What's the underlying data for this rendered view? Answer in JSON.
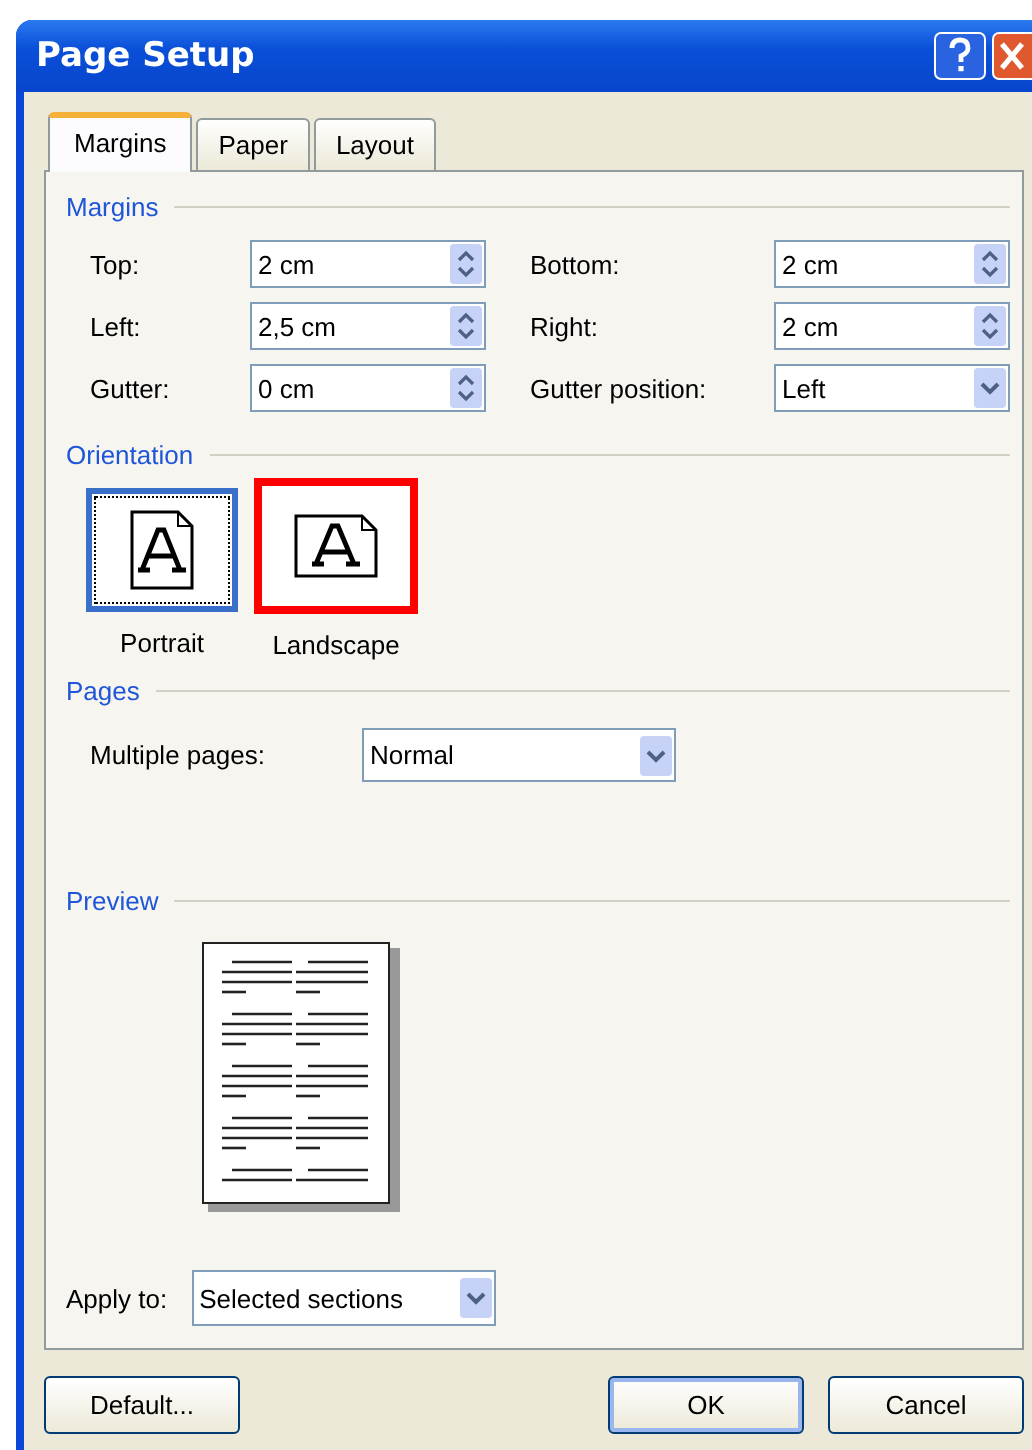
{
  "window": {
    "title": "Page Setup"
  },
  "tabs": [
    {
      "label": "Margins",
      "selected": true
    },
    {
      "label": "Paper",
      "selected": false
    },
    {
      "label": "Layout",
      "selected": false
    }
  ],
  "margins": {
    "heading": "Margins",
    "fields": [
      {
        "label": "Top:",
        "value": "2 cm",
        "kind": "spin"
      },
      {
        "label": "Bottom:",
        "value": "2 cm",
        "kind": "spin"
      },
      {
        "label": "Left:",
        "value": "2,5 cm",
        "kind": "spin"
      },
      {
        "label": "Right:",
        "value": "2 cm",
        "kind": "spin"
      },
      {
        "label": "Gutter:",
        "value": "0 cm",
        "kind": "spin"
      },
      {
        "label": "Gutter position:",
        "value": "Left",
        "kind": "dropdown"
      }
    ]
  },
  "orientation": {
    "heading": "Orientation",
    "options": [
      {
        "label": "Portrait",
        "kind": "portrait",
        "selected": true,
        "highlighted": false
      },
      {
        "label": "Landscape",
        "kind": "landscape",
        "selected": false,
        "highlighted": true
      }
    ]
  },
  "pages": {
    "heading": "Pages",
    "label": "Multiple pages:",
    "value": "Normal"
  },
  "preview": {
    "heading": "Preview",
    "apply_to_label": "Apply to:",
    "apply_to_value": "Selected sections"
  },
  "buttons": [
    {
      "label": "Default...",
      "kind": "secondary"
    },
    {
      "label": "OK",
      "kind": "default"
    },
    {
      "label": "Cancel",
      "kind": "secondary"
    }
  ]
}
